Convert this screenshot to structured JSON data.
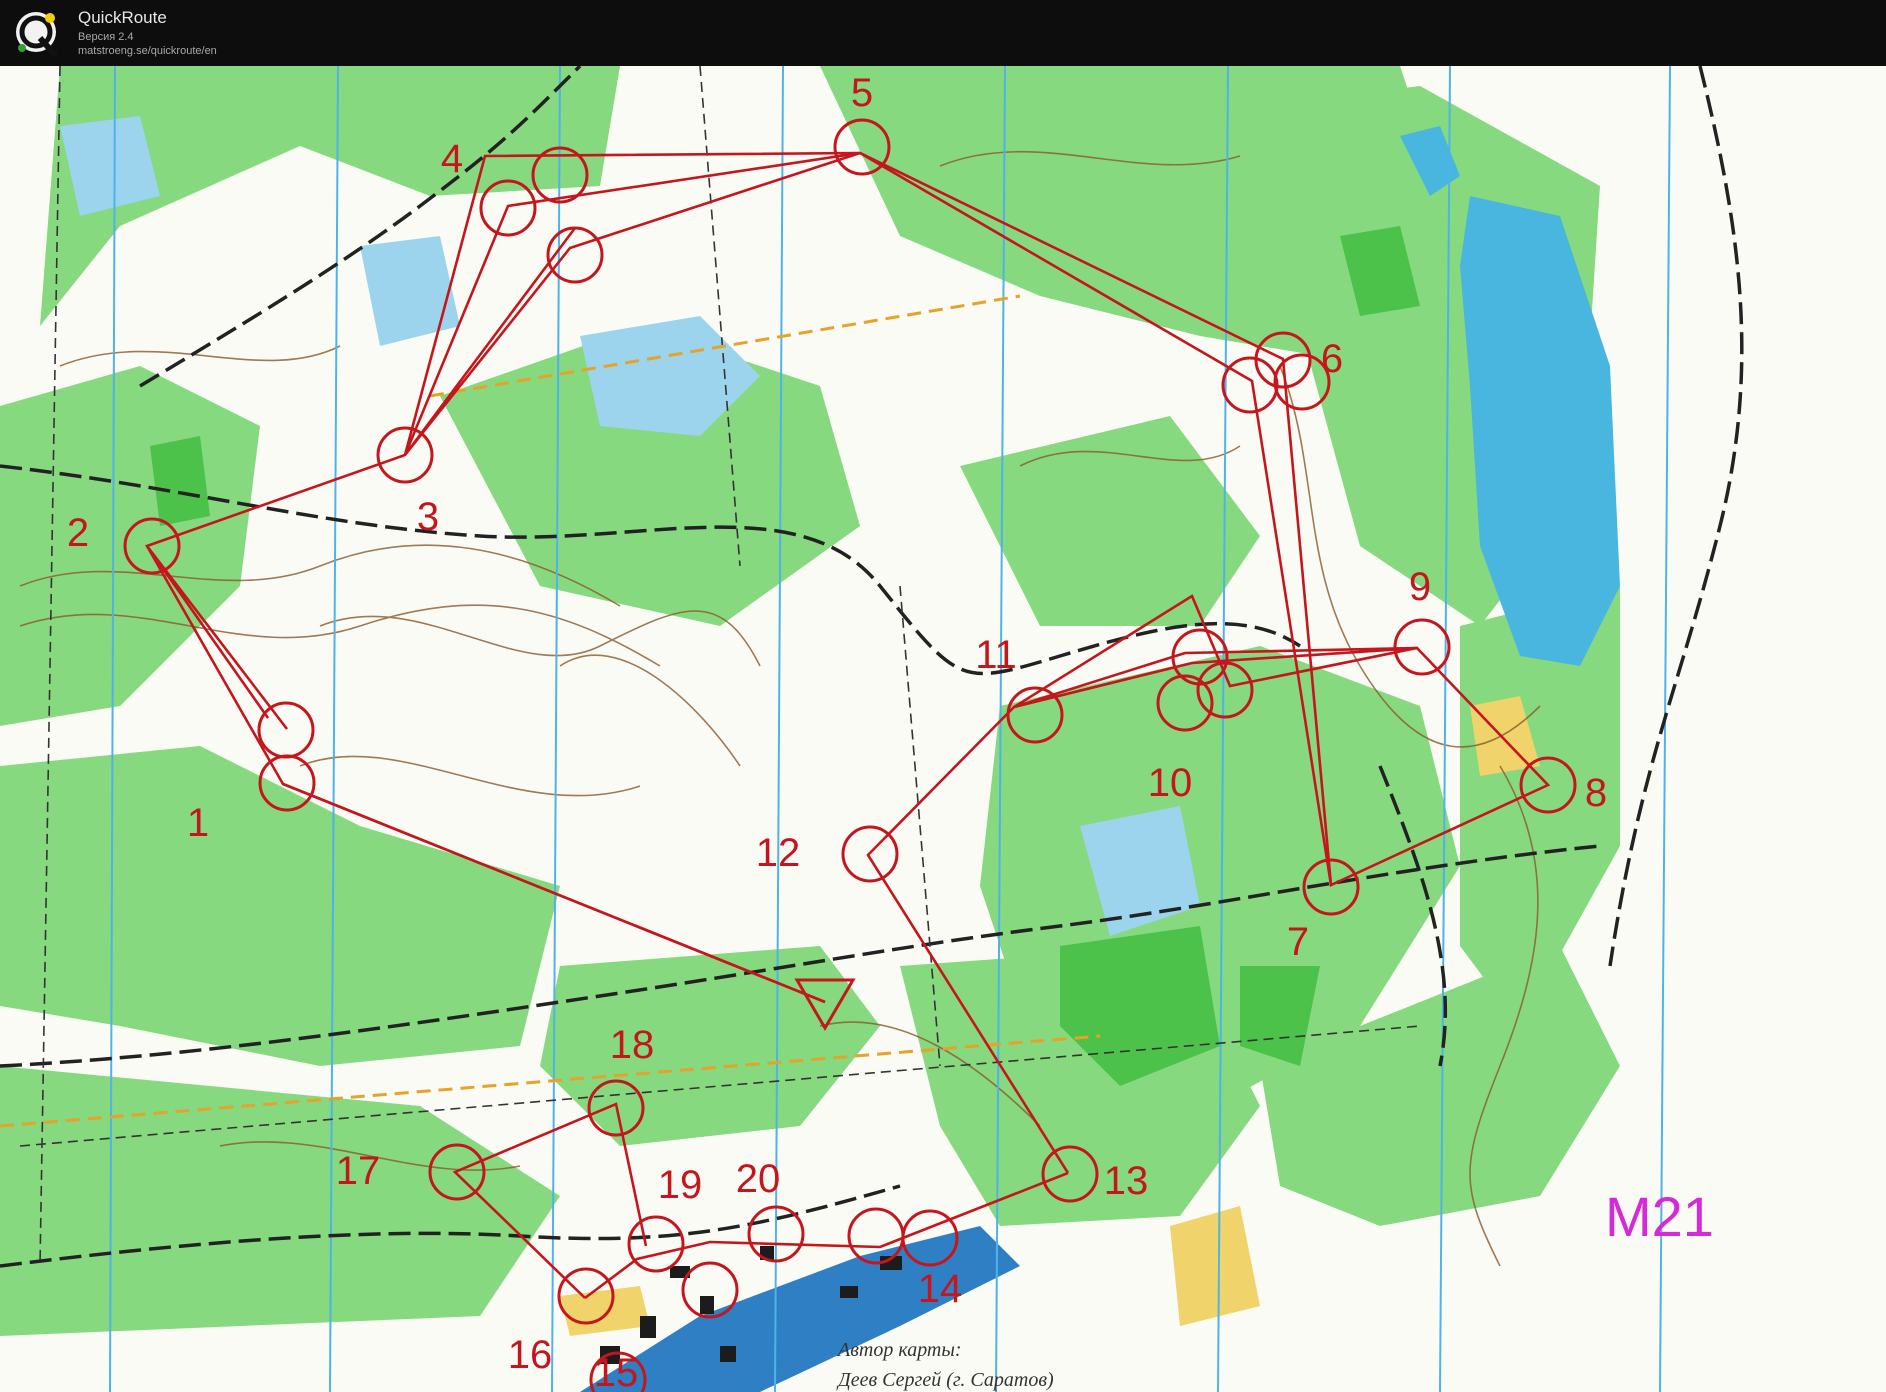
{
  "window": {
    "app_title": "QuickRoute",
    "version": "Версия 2.4",
    "url": "matstroeng.se/quickroute/en"
  },
  "map": {
    "course_name": "M21",
    "credit_line1": "Автор карты:",
    "credit_line2": "Деев Сергей (г. Саратов)",
    "colors": {
      "course": "#c4161c",
      "course_label": "#d42ad8",
      "forest": "#7fd67a",
      "open": "#fbfbf6",
      "water": "#46b8e0",
      "contour": "#8a5a2b",
      "track": "#222222",
      "north_line": "#4fb3e8"
    },
    "controls": [
      {
        "label": "1",
        "icon": "control-circle"
      },
      {
        "label": "2",
        "icon": "control-circle"
      },
      {
        "label": "3",
        "icon": "control-circle"
      },
      {
        "label": "4",
        "icon": "control-circle"
      },
      {
        "label": "5",
        "icon": "control-circle"
      },
      {
        "label": "6",
        "icon": "control-circle"
      },
      {
        "label": "7",
        "icon": "control-circle"
      },
      {
        "label": "8",
        "icon": "control-circle"
      },
      {
        "label": "9",
        "icon": "control-circle"
      },
      {
        "label": "10",
        "icon": "control-circle"
      },
      {
        "label": "11",
        "icon": "control-circle"
      },
      {
        "label": "12",
        "icon": "control-circle"
      },
      {
        "label": "13",
        "icon": "control-circle"
      },
      {
        "label": "14",
        "icon": "control-circle"
      },
      {
        "label": "16",
        "icon": "control-circle"
      },
      {
        "label": "15",
        "icon": "control-circle"
      },
      {
        "label": "17",
        "icon": "control-circle"
      },
      {
        "label": "18",
        "icon": "control-circle"
      },
      {
        "label": "19",
        "icon": "control-circle"
      },
      {
        "label": "20",
        "icon": "control-circle"
      }
    ],
    "start_icon": "start-triangle"
  }
}
